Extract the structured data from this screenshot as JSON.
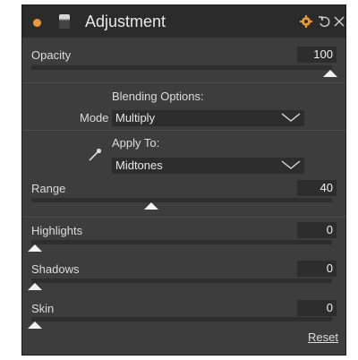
{
  "header": {
    "title": "Adjustment",
    "icons": [
      "status-dot-icon",
      "layer-thumbnail-icon",
      "gear-icon",
      "undo-icon",
      "close-icon"
    ],
    "accent_color": "#f0982e"
  },
  "opacity": {
    "label": "Opacity",
    "value": "100",
    "level": 1.0
  },
  "blending": {
    "heading": "Blending Options:",
    "mode_label": "Mode",
    "mode_value": "Multiply",
    "apply_label": "Apply To:",
    "apply_value": "Midtones"
  },
  "range": {
    "label": "Range",
    "value": "40",
    "level": 0.4
  },
  "highlights": {
    "label": "Highlights",
    "value": "0",
    "level": 0
  },
  "shadows": {
    "label": "Shadows",
    "value": "0",
    "level": 0
  },
  "skin": {
    "label": "Skin",
    "value": "0",
    "level": 0
  },
  "reset_label": "Reset"
}
